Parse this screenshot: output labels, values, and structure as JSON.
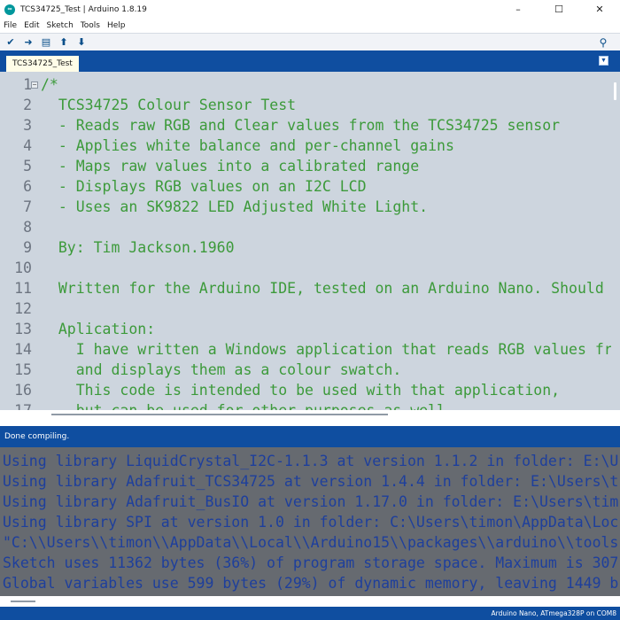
{
  "window": {
    "title": "TCS34725_Test | Arduino 1.8.19",
    "logo_text": "∞",
    "controls": {
      "minimize": "–",
      "maximize": "☐",
      "close": "✕"
    }
  },
  "menu": [
    "File",
    "Edit",
    "Sketch",
    "Tools",
    "Help"
  ],
  "toolbar": {
    "icons": [
      "verify-icon",
      "upload-icon",
      "new-icon",
      "open-icon",
      "save-icon",
      "serial-monitor-icon"
    ],
    "glyphs": {
      "verify": "✔",
      "upload": "➜",
      "new": "▤",
      "open": "⬆",
      "save": "⬇",
      "serial": "⚲"
    }
  },
  "tabs": {
    "active": "TCS34725_Test",
    "menu_glyph": "▼"
  },
  "editor": {
    "fold_glyph": "−",
    "lines": [
      "/*",
      "  TCS34725 Colour Sensor Test",
      "  - Reads raw RGB and Clear values from the TCS34725 sensor",
      "  - Applies white balance and per-channel gains",
      "  - Maps raw values into a calibrated range",
      "  - Displays RGB values on an I2C LCD",
      "  - Uses an SK9822 LED Adjusted White Light.",
      "",
      "  By: Tim Jackson.1960",
      "",
      "  Written for the Arduino IDE, tested on an Arduino Nano. Should b",
      "",
      "  Aplication:",
      "    I have written a Windows application that reads RGB values fro",
      "    and displays them as a colour swatch.",
      "    This code is intended to be used with that application,",
      "    but can be used for other purposes as well."
    ],
    "line_numbers": [
      "1",
      "2",
      "3",
      "4",
      "5",
      "6",
      "7",
      "8",
      "9",
      "10",
      "11",
      "12",
      "13",
      "14",
      "15",
      "16",
      "17"
    ]
  },
  "status": {
    "message": "Done compiling."
  },
  "console": {
    "lines": [
      "Using library LiquidCrystal_I2C-1.1.3 at version 1.1.2 in folder: E:\\U",
      "Using library Adafruit_TCS34725 at version 1.4.4 in folder: E:\\Users\\t",
      "Using library Adafruit_BusIO at version 1.17.0 in folder: E:\\Users\\tim",
      "Using library SPI at version 1.0 in folder: C:\\Users\\timon\\AppData\\Loc",
      "\"C:\\\\Users\\\\timon\\\\AppData\\\\Local\\\\Arduino15\\\\packages\\\\arduino\\\\tools",
      "Sketch uses 11362 bytes (36%) of program storage space. Maximum is 307",
      "Global variables use 599 bytes (29%) of dynamic memory, leaving 1449 b"
    ]
  },
  "board": {
    "info": "Arduino Nano, ATmega328P on COM8"
  },
  "colors": {
    "accent_blue": "#0f4ea0",
    "editor_bg": "#cdd5de",
    "code_green": "#3c9a3a",
    "console_bg": "#666a70",
    "console_text": "#1e3f9c",
    "tab_bg": "#fffde8"
  }
}
